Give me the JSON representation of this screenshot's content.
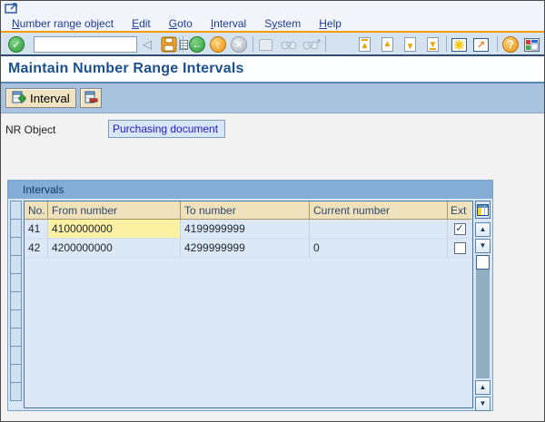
{
  "window": {
    "system_icon": "sap-system-menu-icon"
  },
  "menu_bar": {
    "items": [
      {
        "label": "Number range object",
        "mnemonic_index": 0
      },
      {
        "label": "Edit",
        "mnemonic_index": 0
      },
      {
        "label": "Goto",
        "mnemonic_index": 0
      },
      {
        "label": "Interval",
        "mnemonic_index": 0
      },
      {
        "label": "System",
        "mnemonic_index": 1
      },
      {
        "label": "Help",
        "mnemonic_index": 0
      }
    ]
  },
  "toolbar": {
    "command_field": {
      "value": "",
      "placeholder": ""
    },
    "icons": [
      "enter-icon",
      "command-field",
      "collapse-command-field-icon",
      "save-icon",
      "back-icon",
      "exit-icon",
      "cancel-icon",
      "print-icon",
      "find-icon",
      "find-next-icon",
      "first-page-icon",
      "previous-page-icon",
      "next-page-icon",
      "last-page-icon",
      "new-session-icon",
      "create-shortcut-icon",
      "help-icon",
      "customize-layout-icon"
    ],
    "glyphs": {
      "enter": "✓",
      "back": "←",
      "exit": "↑",
      "cancel": "×",
      "collapse": "◁",
      "help": "?",
      "shortcut": "↗",
      "page_up": "▲",
      "page_down": "▼"
    }
  },
  "page": {
    "title": "Maintain Number Range Intervals"
  },
  "app_toolbar": {
    "interval_button_label": "Interval",
    "interval_button_icon": "insert-interval-icon",
    "delete_button_icon": "delete-interval-icon"
  },
  "form": {
    "nr_object_label": "NR Object",
    "nr_object_value": "Purchasing document"
  },
  "intervals": {
    "box_title": "Intervals",
    "columns": {
      "no": "No.",
      "from": "From number",
      "to": "To number",
      "current": "Current number",
      "ext": "Ext"
    },
    "rows": [
      {
        "no": "41",
        "from": "4100000000",
        "to": "4199999999",
        "current": "",
        "ext_checked": true,
        "from_cell_focused": true
      },
      {
        "no": "42",
        "from": "4200000000",
        "to": "4299999999",
        "current": "0",
        "ext_checked": false,
        "from_cell_focused": false
      }
    ],
    "row_selector_cell_count": 11
  },
  "colors": {
    "accent_orange": "#f39b00",
    "toolbar_bg": "#d5e2f0",
    "app_toolbar_bg": "#a7c3de",
    "title_text": "#1b518f",
    "header_cell_bg": "#f0e1bd",
    "focused_cell_bg": "#fcf0a2",
    "row_bg": "#dce8f5",
    "group_header_bg": "#83add5",
    "menu_text": "#1c3c96",
    "field_text": "#1a1ace",
    "button_bg": "#f1e3c1",
    "check_glyph": "✓"
  }
}
